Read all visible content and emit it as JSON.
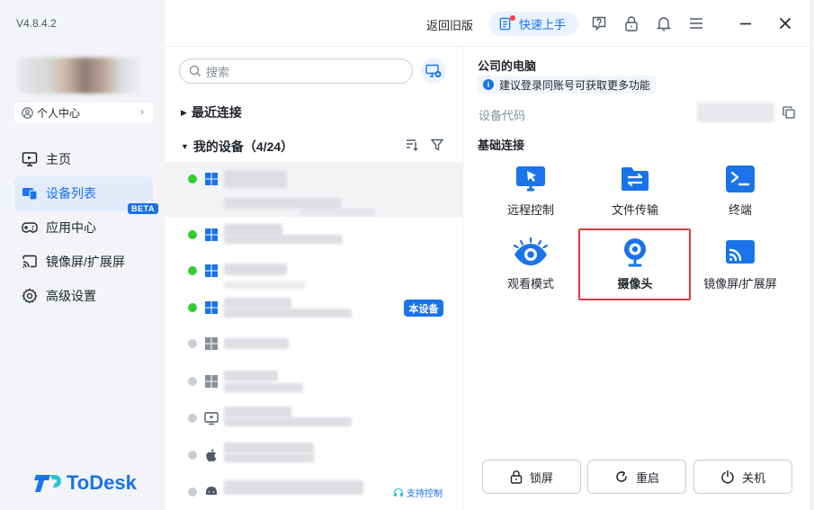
{
  "app": {
    "version": "V4.8.4.2",
    "brand": "ToDesk",
    "accent": "#1a73e8"
  },
  "sidebar": {
    "profile_label": "个人中心",
    "items": [
      {
        "label": "主页",
        "icon": "monitor-icon"
      },
      {
        "label": "设备列表",
        "icon": "device-list-icon",
        "badge": "BETA"
      },
      {
        "label": "应用中心",
        "icon": "gamepad-icon"
      },
      {
        "label": "镜像屏/扩展屏",
        "icon": "cast-icon"
      },
      {
        "label": "高级设置",
        "icon": "gear-icon"
      }
    ]
  },
  "topbar": {
    "old_version": "返回旧版",
    "quick_start": "快速上手"
  },
  "middle": {
    "search_placeholder": "搜索",
    "recent": "最近连接",
    "my_devices": "我的设备（4/24）",
    "this_device_badge": "本设备",
    "support_control": "支持控制"
  },
  "right": {
    "pc_title": "公司的电脑",
    "tip": "建议登录同账号可获取更多功能",
    "code_label": "设备代码",
    "basic_title": "基础连接",
    "features": [
      {
        "label": "远程控制",
        "icon": "remote-control-icon"
      },
      {
        "label": "文件传输",
        "icon": "file-transfer-icon"
      },
      {
        "label": "终端",
        "icon": "terminal-icon"
      },
      {
        "label": "观看模式",
        "icon": "eye-icon"
      },
      {
        "label": "摄像头",
        "icon": "camera-icon"
      },
      {
        "label": "镜像屏/扩展屏",
        "icon": "screen-cast-icon"
      }
    ],
    "actions": [
      {
        "label": "锁屏",
        "icon": "lock-icon"
      },
      {
        "label": "重启",
        "icon": "restart-icon"
      },
      {
        "label": "关机",
        "icon": "power-icon"
      }
    ]
  }
}
